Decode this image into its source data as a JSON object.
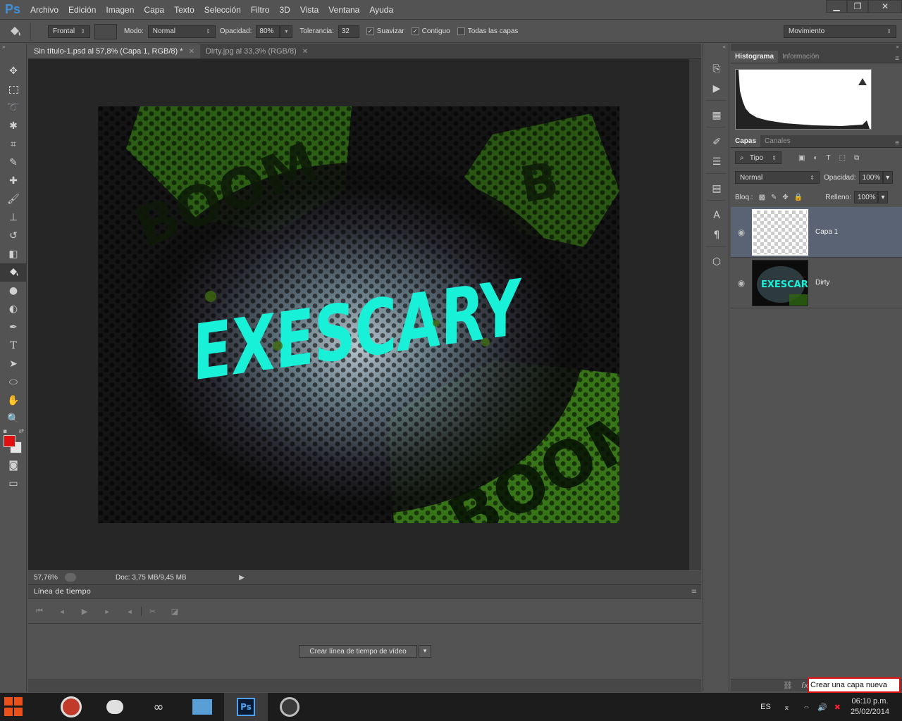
{
  "app": {
    "logo": "Ps"
  },
  "menu": [
    "Archivo",
    "Edición",
    "Imagen",
    "Capa",
    "Texto",
    "Selección",
    "Filtro",
    "3D",
    "Vista",
    "Ventana",
    "Ayuda"
  ],
  "window_controls": {
    "minimize": "▁",
    "restore": "❐",
    "close": "✕"
  },
  "options": {
    "source": "Frontal",
    "mode_label": "Modo:",
    "mode": "Normal",
    "opacity_label": "Opacidad:",
    "opacity": "80%",
    "tolerance_label": "Tolerancia:",
    "tolerance": "32",
    "antialias": "Suavizar",
    "contiguous": "Contiguo",
    "all_layers": "Todas las capas",
    "workspace": "Movimiento"
  },
  "tabs": [
    {
      "label": "Sin título-1.psd al 57,8% (Capa 1, RGB/8) *"
    },
    {
      "label": "Dirty.jpg al 33,3% (RGB/8)"
    }
  ],
  "artwork": {
    "main_text": "EXESCARY",
    "boom_text": "BOOM",
    "colors": {
      "neon": "#18f0d8",
      "green": "#4caf20",
      "dark": "#0b0b0b"
    }
  },
  "status": {
    "zoom": "57,76%",
    "doc": "Doc: 3,75 MB/9,45 MB"
  },
  "timeline": {
    "title": "Línea de tiempo",
    "create_button": "Crear línea de tiempo de vídeo"
  },
  "panels": {
    "histogram_tab": "Histograma",
    "info_tab": "Información",
    "layers_tab": "Capas",
    "channels_tab": "Canales",
    "filter_kind": "Tipo",
    "blend_mode": "Normal",
    "opacity_label": "Opacidad:",
    "opacity": "100%",
    "lock_label": "Bloq.:",
    "fill_label": "Relleno:",
    "fill": "100%",
    "layers": [
      {
        "name": "Capa 1",
        "selected": true
      },
      {
        "name": "Dirty",
        "selected": false
      }
    ],
    "tooltip": "Crear una capa nueva"
  },
  "taskbar": {
    "language": "ES",
    "time": "06:10 p.m.",
    "date": "25/02/2014"
  }
}
